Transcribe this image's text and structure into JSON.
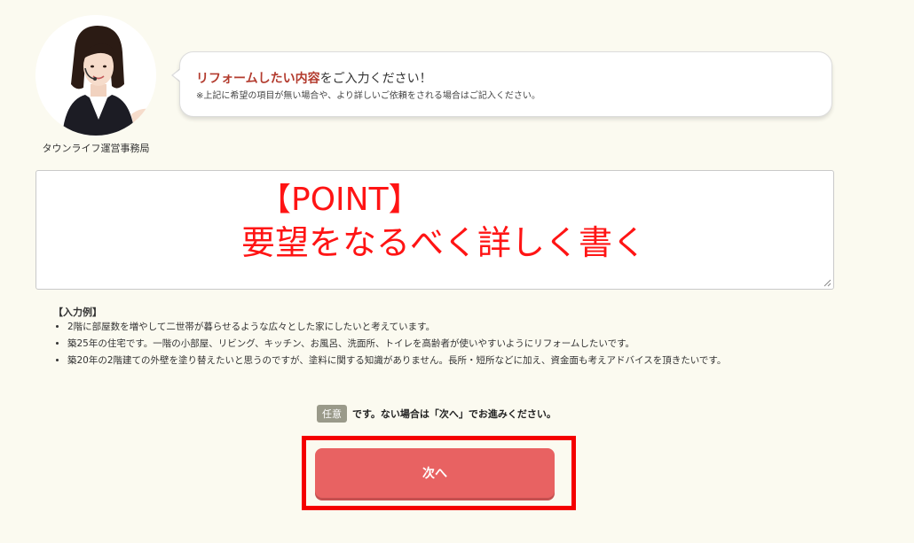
{
  "operator": {
    "caption": "タウンライフ運営事務局"
  },
  "bubble": {
    "title_strong": "リフォームしたい内容",
    "title_rest": "をご入力ください！",
    "note": "※上記に希望の項目が無い場合や、より詳しいご依頼をされる場合はご記入ください。"
  },
  "textarea": {
    "value": ""
  },
  "overlay": {
    "point": "【POINT】",
    "detail": "要望をなるべく詳しく書く"
  },
  "examples": {
    "title": "【入力例】",
    "items": [
      "2階に部屋数を増やして二世帯が暮らせるような広々とした家にしたいと考えています。",
      "築25年の住宅です。一階の小部屋、リビング、キッチン、お風呂、洗面所、トイレを高齢者が使いやすいようにリフォームしたいです。",
      "築20年の2階建ての外壁を塗り替えたいと思うのですが、塗料に関する知識がありません。長所・短所などに加え、資金面も考えアドバイスを頂きたいです。"
    ]
  },
  "optional": {
    "badge": "任意",
    "text": "です。ない場合は「次へ」でお進みください。"
  },
  "next_button": {
    "label": "次へ"
  },
  "colors": {
    "accent_red": "#e86262",
    "frame_red": "#f40000",
    "title_red": "#b33b2e",
    "background": "#fbfaf0"
  }
}
